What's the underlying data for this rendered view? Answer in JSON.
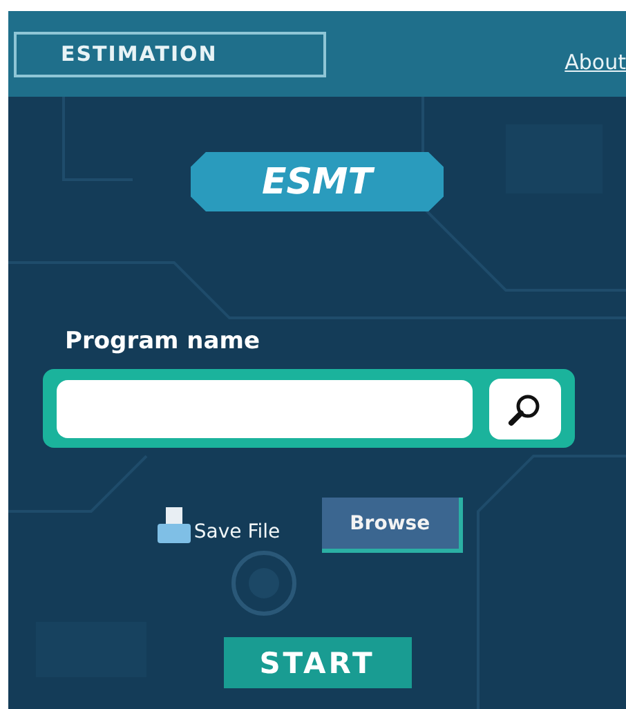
{
  "header": {
    "title": "ESTIMATION",
    "link": "About"
  },
  "logo": {
    "text": "ESMT"
  },
  "program_name": {
    "label": "Program name"
  },
  "save_file": {
    "label": "Save File",
    "button": "Browse"
  },
  "start_button": "START"
}
